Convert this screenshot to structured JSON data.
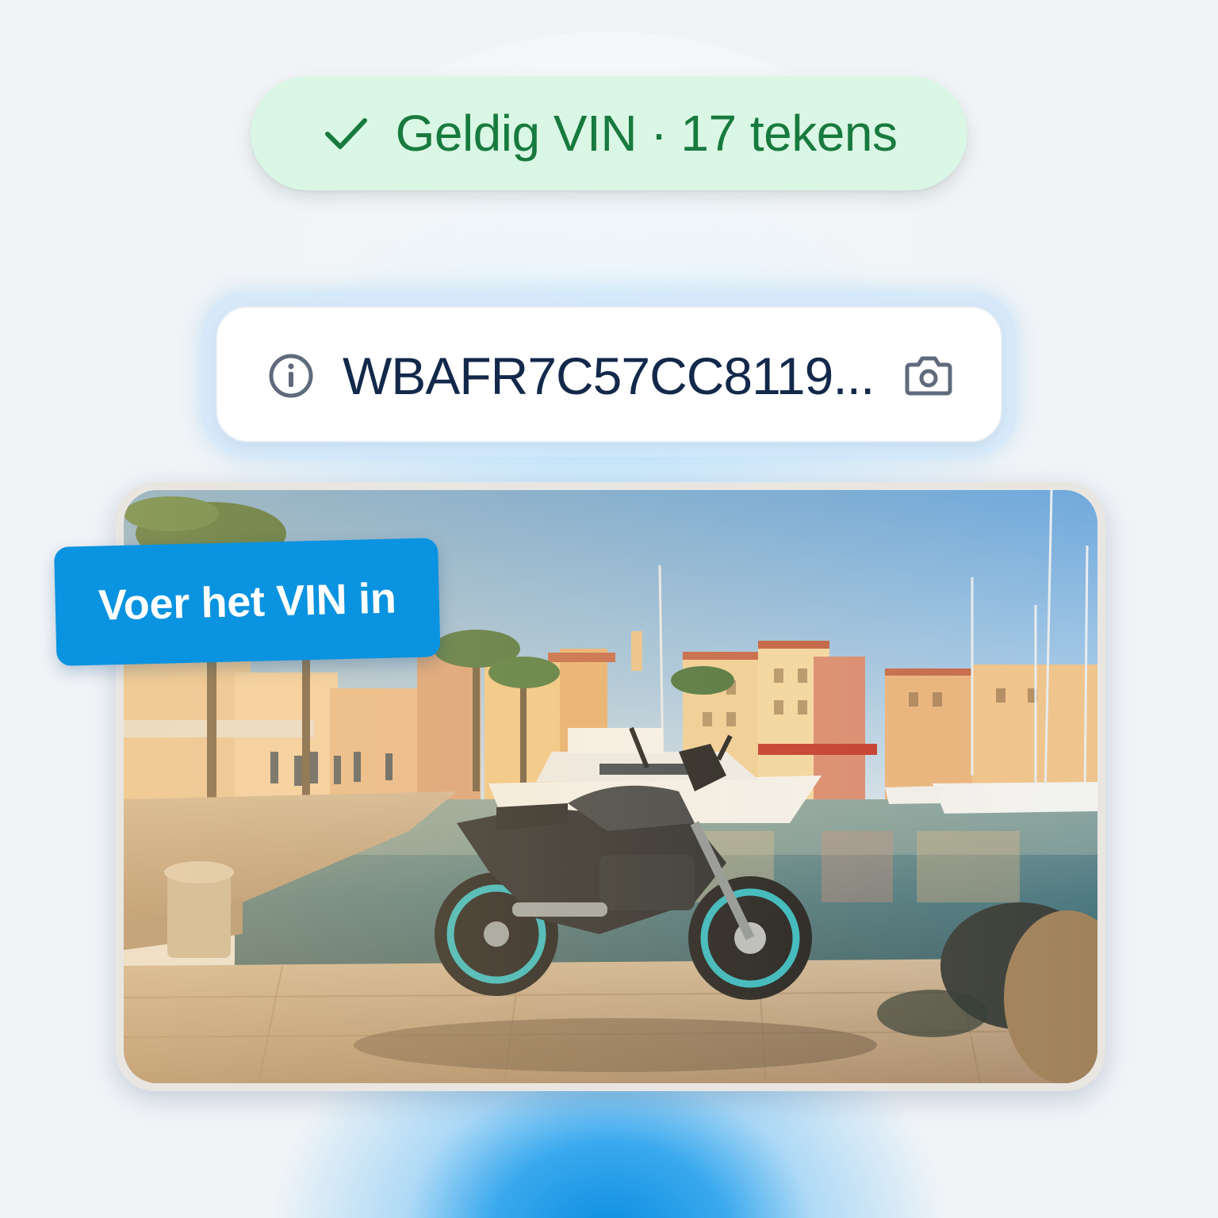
{
  "status": {
    "text": "Geldig VIN · 17 tekens",
    "icon": "check-icon",
    "color": "#187a3e",
    "background": "#daf7e5"
  },
  "vin_field": {
    "value": "WBAFR7C57CC8119...",
    "leading_icon": "info-icon",
    "trailing_icon": "camera-icon"
  },
  "tag": {
    "label": "Voer het VIN in",
    "color": "#0a93e0"
  },
  "photo": {
    "subject": "motorcycle-harbor-photo"
  }
}
